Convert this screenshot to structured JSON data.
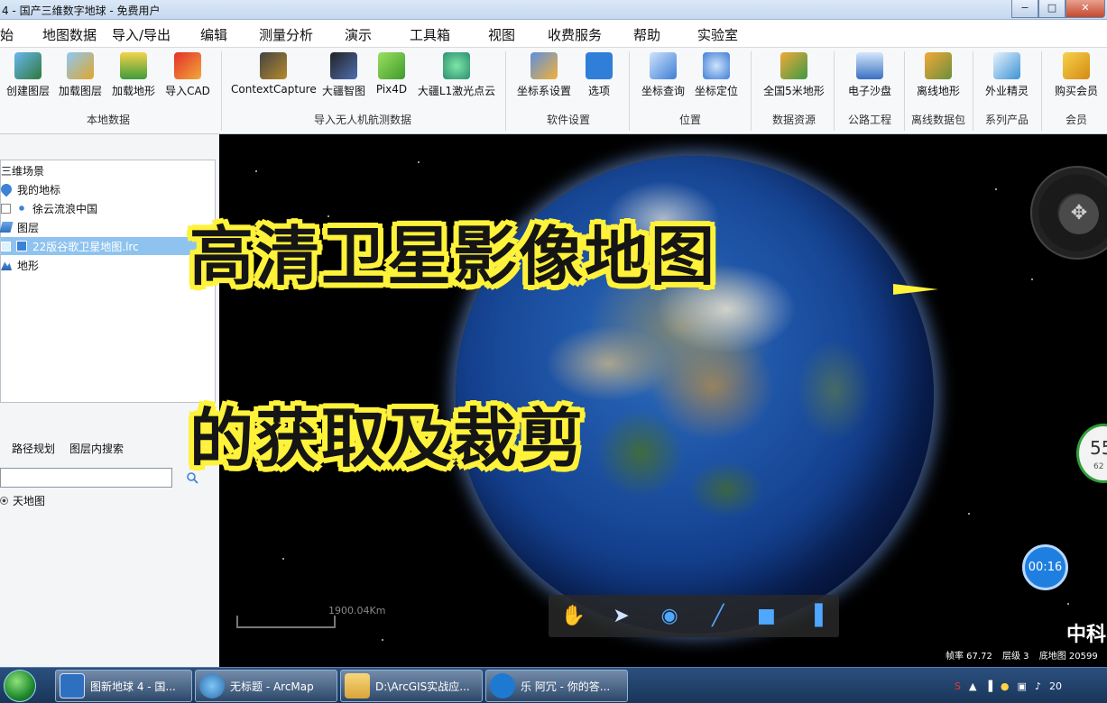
{
  "window": {
    "title": "4 - 国产三维数字地球 - 免费用户"
  },
  "menu": {
    "tabs": [
      "始",
      "地图数据",
      "导入/导出",
      "编辑",
      "测量分析",
      "演示",
      "工具箱",
      "视图",
      "收费服务",
      "帮助",
      "实验室"
    ]
  },
  "ribbon": {
    "items": {
      "create_layer": "创建图层",
      "load_layer": "加载图层",
      "load_terrain": "加载地形",
      "import_cad": "导入CAD",
      "context_capture": "ContextCapture",
      "dji_terra": "大疆智图",
      "pix4d": "Pix4D",
      "dji_l1": "大疆L1激光点云",
      "coord_settings": "坐标系设置",
      "options": "选项",
      "coord_query": "坐标查询",
      "coord_locate": "坐标定位",
      "terrain_5m": "全国5米地形",
      "sandbox": "电子沙盘",
      "offline_terrain": "离线地形",
      "field_expert": "外业精灵",
      "buy_member": "购买会员"
    },
    "groups": {
      "local_data": "本地数据",
      "drone_import": "导入无人机航测数据",
      "software_settings": "软件设置",
      "position": "位置",
      "data_resources": "数据资源",
      "highway": "公路工程",
      "offline_package": "离线数据包",
      "product_series": "系列产品",
      "member": "会员"
    }
  },
  "left_panel": {
    "tree": {
      "root": "三维场景",
      "my_places": "我的地标",
      "xu_yun": "徐云流浪中国",
      "layers": "图层",
      "layer_file": "22版谷歌卫星地图.lrc",
      "terrain": "地形"
    },
    "subtabs": {
      "route": "路径规划",
      "layer_search": "图层内搜索"
    },
    "search": {
      "value": ""
    },
    "radio_option": "天地图"
  },
  "viewport": {
    "caption_line1": "高清卫星影像地图",
    "caption_line2": "的获取及裁剪",
    "scale_label": "1900.04Km",
    "gauge_value": "55",
    "gauge_sub": "62",
    "timer": "00:16",
    "watermark": "中科",
    "status": {
      "frame_rate": "帧率 67.72",
      "level": "层级 3",
      "base": "底地图 20599"
    }
  },
  "taskbar": {
    "tasks": [
      {
        "label": "图新地球 4 - 国..."
      },
      {
        "label": "无标题 - ArcMap"
      },
      {
        "label": "D:\\ArcGIS实战应..."
      },
      {
        "label": "乐 阿冗 - 你的答..."
      }
    ],
    "clock": "20"
  }
}
